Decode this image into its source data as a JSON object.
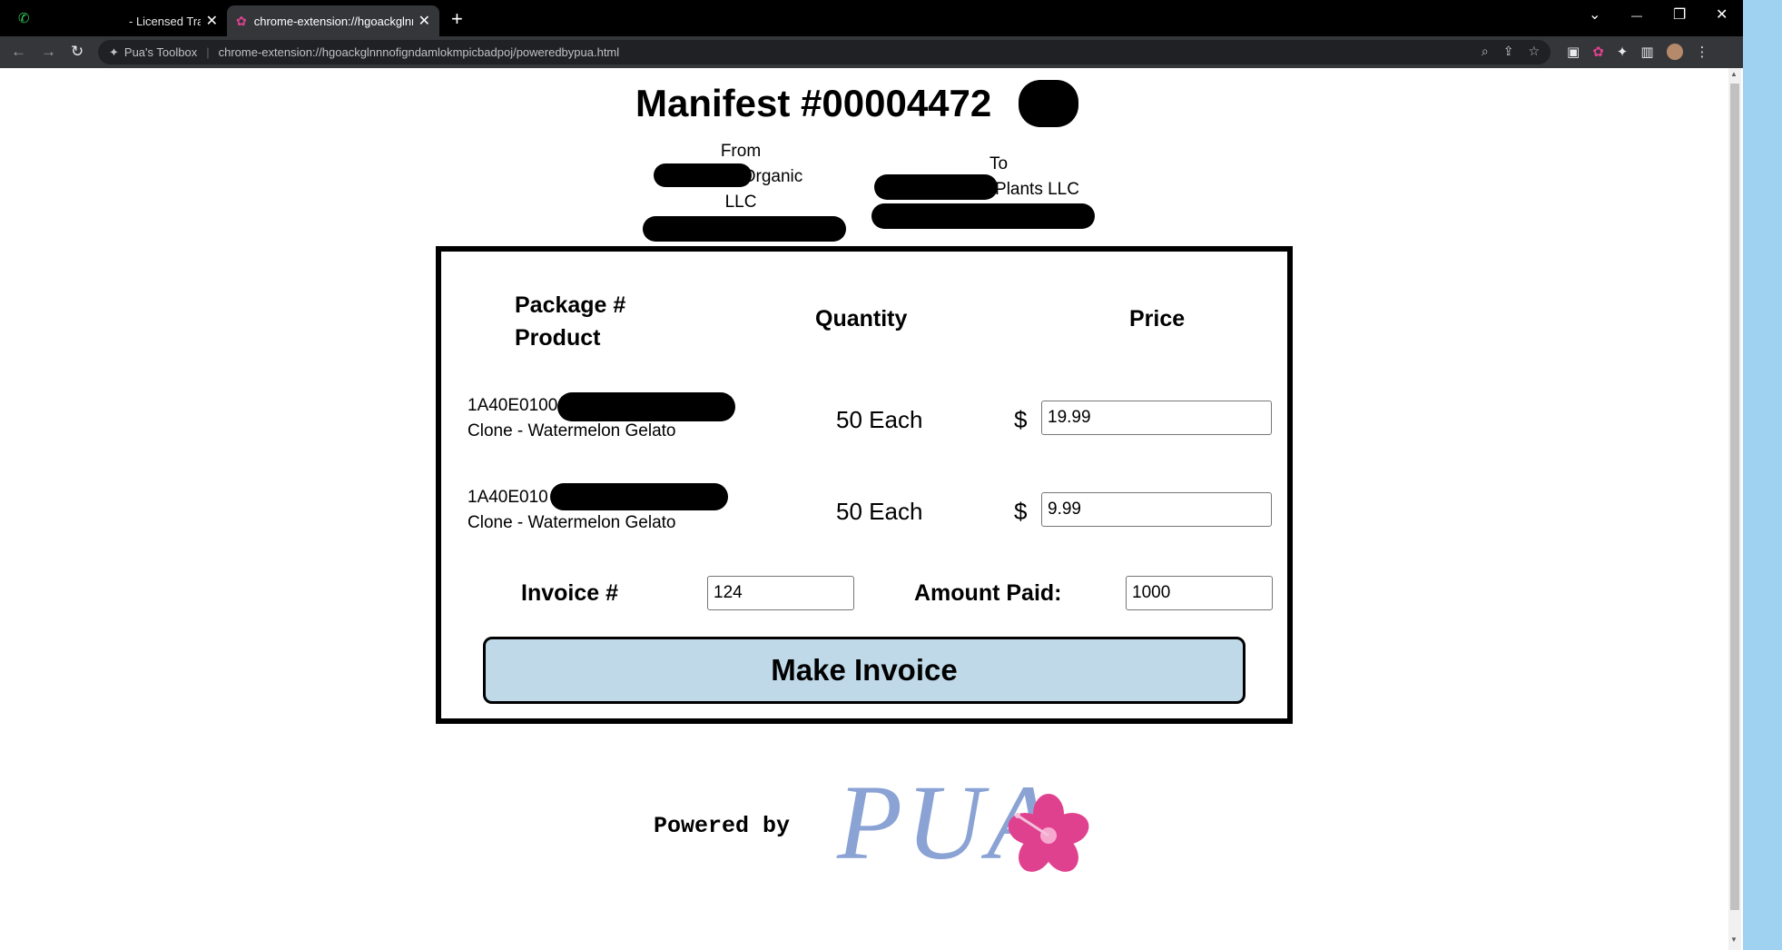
{
  "browser": {
    "tabs": [
      {
        "title": "- Licensed Tra",
        "close": "✕"
      },
      {
        "title": "chrome-extension://hgoackglnn",
        "close": "✕"
      }
    ],
    "new_tab": "+",
    "window_controls": {
      "chevron": "⌄",
      "minimize": "—",
      "restore": "❐",
      "close": "✕"
    },
    "nav": {
      "back": "←",
      "forward": "→",
      "reload": "↻"
    },
    "omnibox": {
      "extension_label": "Pua's Toolbox",
      "separator": "|",
      "url": "chrome-extension://hgoackglnnnofigndamlokmpicbadpoj/poweredbypua.html"
    }
  },
  "manifest": {
    "title": "Manifest #00004472",
    "from": {
      "label": "From",
      "name_suffix": "Organic",
      "name_line2": "LLC"
    },
    "to": {
      "label": "To",
      "name_suffix": "Plants LLC"
    }
  },
  "table": {
    "headers": {
      "package_line1": "Package #",
      "package_line2": "Product",
      "quantity": "Quantity",
      "price": "Price"
    },
    "rows": [
      {
        "package": "1A40E0100",
        "product": "Clone - Watermelon Gelato",
        "quantity": "50 Each",
        "currency": "$",
        "price": "19.99"
      },
      {
        "package": "1A40E010",
        "product": "Clone - Watermelon Gelato",
        "quantity": "50 Each",
        "currency": "$",
        "price": "9.99"
      }
    ]
  },
  "invoice": {
    "label": "Invoice #",
    "value": "124"
  },
  "amount_paid": {
    "label": "Amount Paid:",
    "value": "1000"
  },
  "make_invoice_button": "Make Invoice",
  "footer": {
    "powered_by": "Powered by",
    "logo_text": "PUA"
  },
  "colors": {
    "button_bg": "#c0d9e8",
    "logo_blue": "#8aa3d4",
    "flower_pink": "#e0418f"
  }
}
